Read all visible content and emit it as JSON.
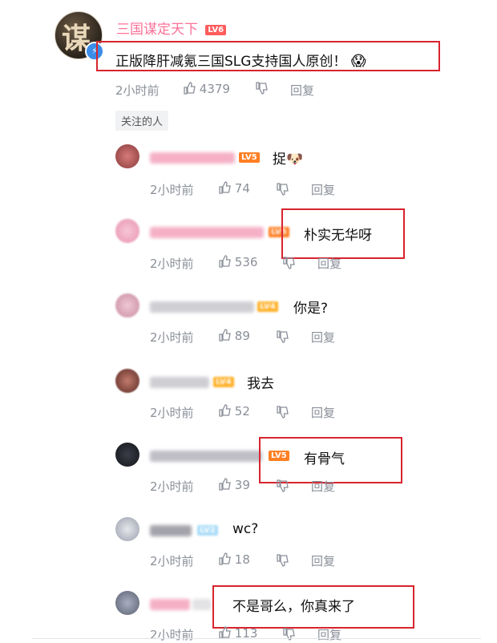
{
  "main_comment": {
    "author": "三国谋定天下",
    "level": "LV6",
    "text": "正版降肝减氪三国SLG支持国人原创！",
    "emoji": "😱",
    "time": "2小时前",
    "likes": "4379",
    "reply_label": "回复"
  },
  "follow_tag": "关注的人",
  "replies": [
    {
      "level": "LV5",
      "text": "捉🐶",
      "time": "2小时前",
      "likes": "74",
      "reply_label": "回复"
    },
    {
      "level": "LV5",
      "text": "朴实无华呀",
      "time": "2小时前",
      "likes": "536",
      "reply_label": "回复"
    },
    {
      "level": "LV4",
      "text": "你是?",
      "time": "2小时前",
      "likes": "89",
      "reply_label": "回复"
    },
    {
      "level": "LV4",
      "text": "我去",
      "time": "2小时前",
      "likes": "52",
      "reply_label": "回复"
    },
    {
      "level": "LV5",
      "text": "有骨气",
      "time": "2小时前",
      "likes": "39",
      "reply_label": "回复"
    },
    {
      "level": "LV2",
      "text": "wc?",
      "time": "2小时前",
      "likes": "18",
      "reply_label": "回复"
    },
    {
      "level": "",
      "text": "不是哥么，你真来了",
      "time": "2小时前",
      "likes": "113",
      "reply_label": "回复"
    }
  ],
  "colors": {
    "name_pink": "#fb7299",
    "highlight_red": "#d8242e",
    "meta_gray": "#8a8f98"
  }
}
